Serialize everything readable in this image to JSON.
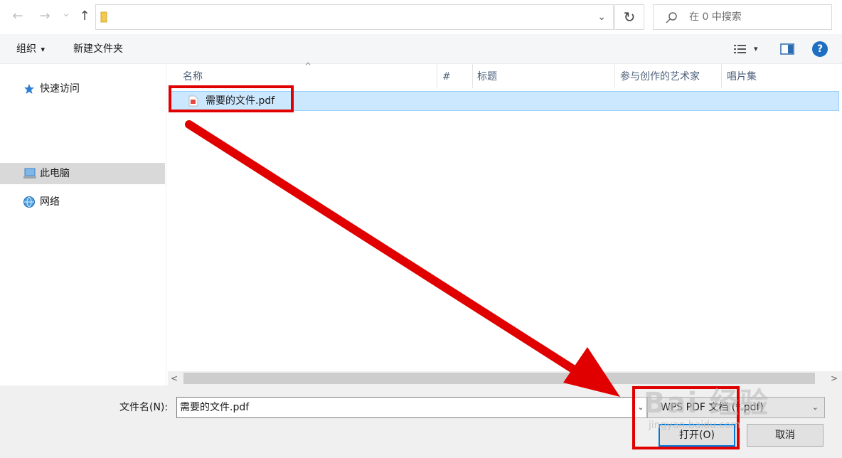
{
  "address_bar": {
    "back_icon": "←",
    "forward_icon": "→",
    "history_icon": "⌄",
    "up_icon": "↑",
    "path_dropdown_icon": "⌄",
    "refresh_icon": "↻",
    "search_icon": "⚲",
    "search_placeholder": "在 0 中搜索"
  },
  "toolbar": {
    "organize_label": "组织",
    "organize_caret": "▾",
    "new_folder_label": "新建文件夹",
    "view_caret": "▾",
    "help_label": "?"
  },
  "nav_pane": {
    "items": [
      {
        "label": "快速访问",
        "icon": "star-icon"
      },
      {
        "label": "此电脑",
        "icon": "computer-icon"
      },
      {
        "label": "网络",
        "icon": "network-icon"
      }
    ]
  },
  "columns": [
    "名称",
    "#",
    "标题",
    "参与创作的艺术家",
    "唱片集"
  ],
  "sort_indicator": "^",
  "files": [
    {
      "name": "需要的文件.pdf",
      "icon": "pdf-file-icon"
    }
  ],
  "scrollbar": {
    "left_arrow": "<",
    "right_arrow": ">"
  },
  "bottom": {
    "filename_label": "文件名(N):",
    "filename_value": "需要的文件.pdf",
    "filename_dropdown": "⌄",
    "filetype_value": "WPS PDF 文档 (*.pdf)",
    "filetype_caret": "⌄",
    "open_label": "打开(O)",
    "cancel_label": "取消"
  },
  "annotations": {
    "highlight_color": "#e00000"
  },
  "watermark": {
    "brand": "Bai 经验",
    "url": "jingyan.baidu.com"
  }
}
